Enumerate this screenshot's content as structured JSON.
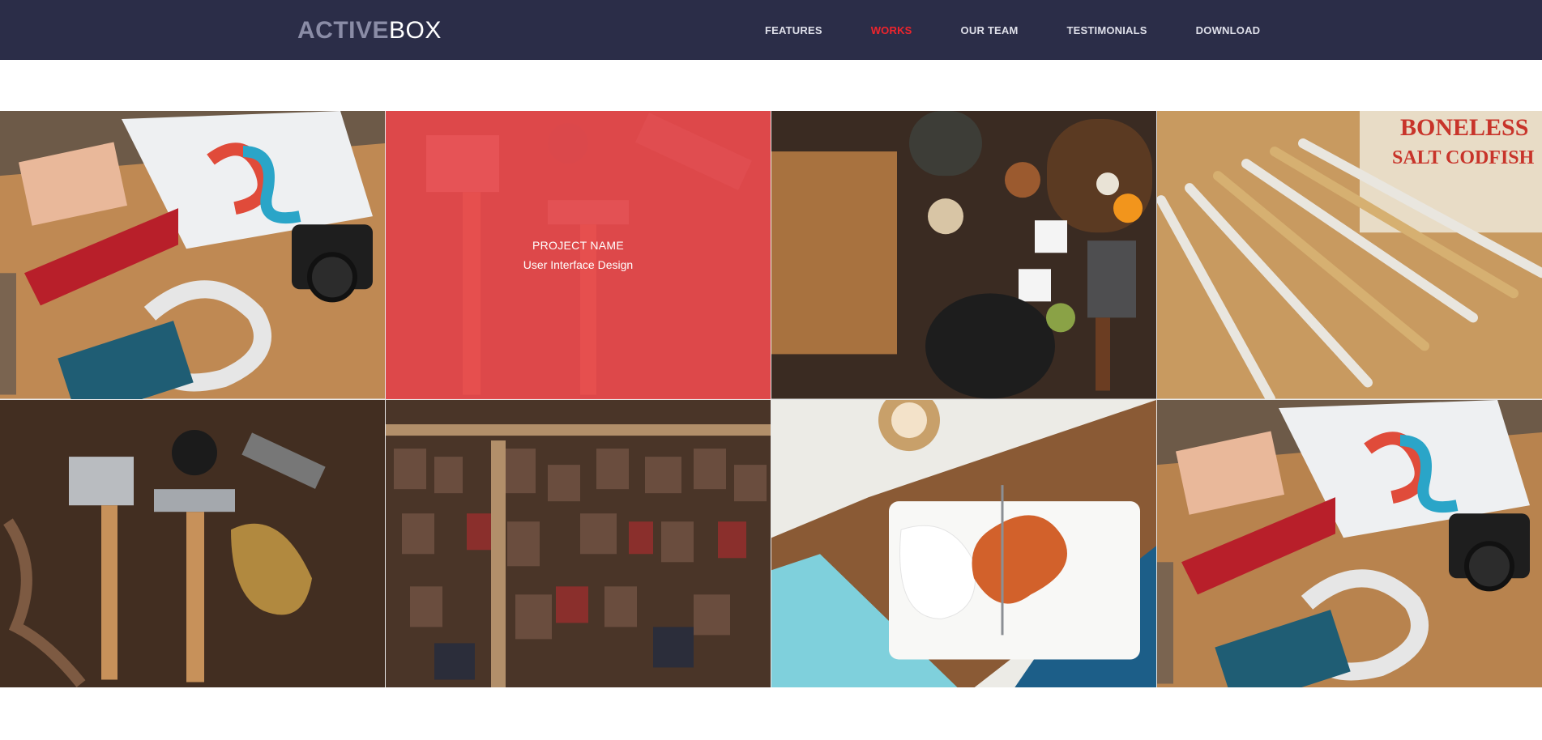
{
  "header": {
    "logo_bold": "ACTIVE",
    "logo_light": "BOX",
    "nav": [
      {
        "label": "FEATURES",
        "active": false
      },
      {
        "label": "WORKS",
        "active": true
      },
      {
        "label": "OUR TEAM",
        "active": false
      },
      {
        "label": "TESTIMONIALS",
        "active": false
      },
      {
        "label": "DOWNLOAD",
        "active": false
      }
    ]
  },
  "colors": {
    "header_bg": "#2b2d48",
    "accent": "#f0242c",
    "overlay": "#e84a4e"
  },
  "gallery": {
    "hovered_item": {
      "title": "PROJECT NAME",
      "category": "User Interface Design"
    },
    "items": [
      {
        "image": "desk-tshirt-pennant-camera-photo"
      },
      {
        "image": "axe-hammer-tools-photo"
      },
      {
        "image": "kitchen-board-spices-skillet-photo"
      },
      {
        "image": "wooden-rulers-codfish-sign-photo"
      },
      {
        "image": "rustic-tools-axe-gloves-photo"
      },
      {
        "image": "letterpress-wood-type-photo"
      },
      {
        "image": "plate-of-food-coffee-table-photo"
      },
      {
        "image": "desk-tshirt-pennant-camera-photo"
      }
    ]
  }
}
